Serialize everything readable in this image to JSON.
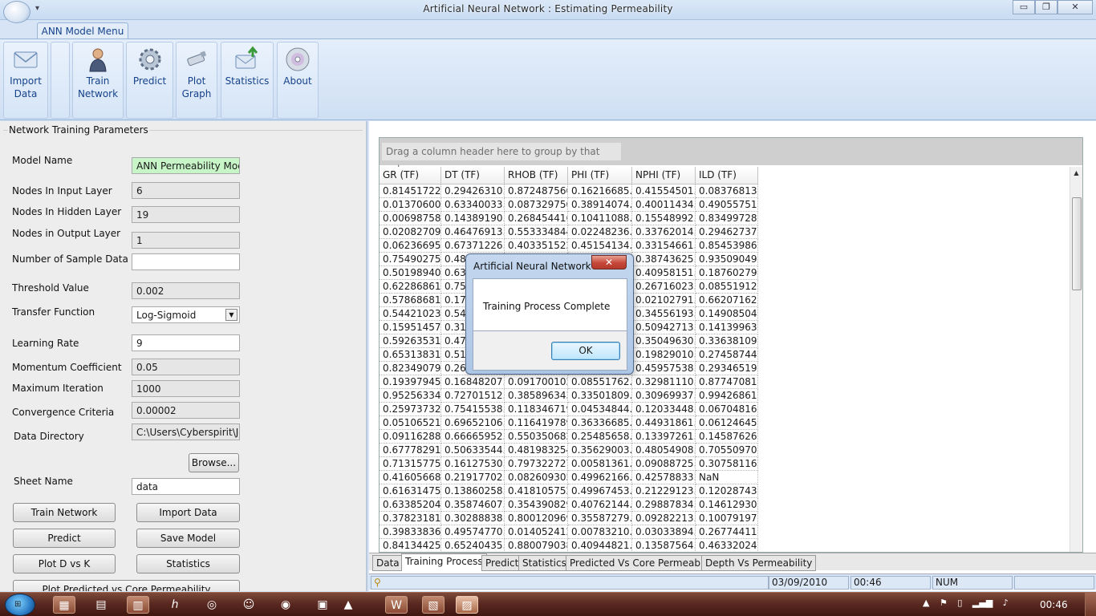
{
  "window": {
    "title": "Artificial Neural Network : Estimating Permeability",
    "qat_icons": [
      "dropdown-icon"
    ],
    "controls": {
      "minimize": "▭",
      "maximize": "❐",
      "close": "✕"
    }
  },
  "ribbon": {
    "tab": "ANN Model Menu",
    "buttons": [
      {
        "line1": "Import",
        "line2": "Data",
        "icon": "envelope-icon"
      },
      {
        "line1": "Train",
        "line2": "Network",
        "icon": "person-icon"
      },
      {
        "line1": "Predict",
        "line2": "",
        "icon": "gear-icon"
      },
      {
        "line1": "Plot",
        "line2": "Graph",
        "icon": "usb-drive-icon"
      },
      {
        "line1": "Statistics",
        "line2": "",
        "icon": "mail-upload-icon"
      },
      {
        "line1": "About",
        "line2": "",
        "icon": "disc-icon"
      }
    ]
  },
  "params": {
    "group_title": "Network Training Parameters",
    "model_name_label": "Model Name",
    "model_name": "ANN Permeability Model",
    "input_layer_label": "Nodes In Input Layer",
    "input_layer": "6",
    "hidden_layer_label": "Nodes In Hidden Layer",
    "hidden_layer": "19",
    "output_layer_label": "Nodes in Output Layer",
    "output_layer": "1",
    "sample_label": "Number of  Sample Data",
    "sample": "",
    "threshold_label": "Threshold Value",
    "threshold": "0.002",
    "transfer_label": "Transfer Function",
    "transfer": "Log-Sigmoid",
    "learning_label": "Learning Rate",
    "learning": "9",
    "momentum_label": "Momentum Coefficient",
    "momentum": "0.05",
    "max_iter_label": "Maximum Iteration",
    "max_iter": "1000",
    "convergence_label": "Convergence Criteria",
    "convergence": "0.00002",
    "data_dir_label": "Data Directory",
    "data_dir": "C:\\Users\\Cyberspirit\\Job",
    "browse": "Browse...",
    "sheet_label": "Sheet Name",
    "sheet": "data",
    "btn_train": "Train Network",
    "btn_import": "Import Data",
    "btn_predict": "Predict",
    "btn_save": "Save Model",
    "btn_plot": "Plot D vs K",
    "btn_stats": "Statistics",
    "btn_plot_pred": "Plot Predicted vs Core Permeability"
  },
  "grid": {
    "group_hint": "Drag a column header here to group by that column.",
    "columns": [
      "GR (TF)",
      "DT (TF)",
      "RHOB (TF)",
      "PHI (TF)",
      "NPHI (TF)",
      "ILD (TF)"
    ],
    "rows": [
      [
        "0.81451722...",
        "0.29426310...",
        "0.872487560...",
        "0.16216685...",
        "0.41554501...",
        "0.08376813..."
      ],
      [
        "0.01370600...",
        "0.63340033...",
        "0.087329750...",
        "0.38914074...",
        "0.40011434...",
        "0.49055751..."
      ],
      [
        "0.00698758...",
        "0.14389190...",
        "0.268454416...",
        "0.10411088...",
        "0.15548992...",
        "0.83499728..."
      ],
      [
        "0.02082709...",
        "0.46476913...",
        "0.553334844...",
        "0.02248236...",
        "0.33762014...",
        "0.29462737..."
      ],
      [
        "0.06236695...",
        "0.67371226...",
        "0.403351522...",
        "0.45154134...",
        "0.33154661...",
        "0.85453986..."
      ],
      [
        "0.75490275...",
        "0.48",
        "",
        "",
        "0.38743625...",
        "0.93509049..."
      ],
      [
        "0.50198940...",
        "0.63",
        "",
        "",
        "0.40958151...",
        "0.18760279..."
      ],
      [
        "0.62286861...",
        "0.75",
        "",
        "",
        "0.26716023...",
        "0.08551912..."
      ],
      [
        "0.57868681...",
        "0.17",
        "",
        "",
        "0.02102791...",
        "0.66207162..."
      ],
      [
        "0.54421023...",
        "0.54",
        "",
        "",
        "0.34556193...",
        "0.14908504..."
      ],
      [
        "0.15951457...",
        "0.31",
        "",
        "",
        "0.50942713...",
        "0.14139963..."
      ],
      [
        "0.59263531...",
        "0.47",
        "",
        "",
        "0.35049630...",
        "0.33638109..."
      ],
      [
        "0.65313831...",
        "0.51",
        "",
        "",
        "0.19829010...",
        "0.27458744..."
      ],
      [
        "0.82349079...",
        "0.26",
        "",
        "",
        "0.45957538...",
        "0.29346519..."
      ],
      [
        "0.19397945...",
        "0.16848207...",
        "0.091700102...",
        "0.08551762...",
        "0.32981110...",
        "0.87747081..."
      ],
      [
        "0.95256334...",
        "0.72701512...",
        "0.385896343...",
        "0.33501809...",
        "0.30969937...",
        "0.99426861..."
      ],
      [
        "0.25973732...",
        "0.75415538...",
        "0.118346719...",
        "0.04534844...",
        "0.12033448...",
        "0.06704816..."
      ],
      [
        "0.05106521...",
        "0.69652106...",
        "0.116419789...",
        "0.36336685...",
        "0.44931861...",
        "0.06124645..."
      ],
      [
        "0.09116288...",
        "0.66665952...",
        "0.550350682...",
        "0.25485658...",
        "0.13397261...",
        "0.14587626..."
      ],
      [
        "0.67778291...",
        "0.50633544...",
        "0.481983254...",
        "0.35629003...",
        "0.48054908...",
        "0.70550970..."
      ],
      [
        "0.71315775...",
        "0.16127530...",
        "0.797322727...",
        "0.00581361...",
        "0.09088725...",
        "0.30758116..."
      ],
      [
        "0.41605668...",
        "0.21917702...",
        "0.082609305...",
        "0.49962166...",
        "0.42578833...",
        "NaN"
      ],
      [
        "0.61631475...",
        "0.13860258...",
        "0.418105752...",
        "0.49967453...",
        "0.21229123...",
        "0.12028743..."
      ],
      [
        "0.63385204...",
        "0.35874607...",
        "0.354390829...",
        "0.40762144...",
        "0.29887834...",
        "0.14612930..."
      ],
      [
        "0.37823181...",
        "0.30288838...",
        "0.800120969...",
        "0.35587279...",
        "0.09282213...",
        "0.10079197..."
      ],
      [
        "0.39833836...",
        "0.49574770...",
        "0.014052412...",
        "0.00783210...",
        "0.03033894...",
        "0.26774411..."
      ],
      [
        "0.84134425...",
        "0.65240435...",
        "0.880079038...",
        "0.40944821...",
        "0.13587564...",
        "0.46332024..."
      ]
    ]
  },
  "tabs": [
    "Data",
    "Training Process",
    "Predict",
    "Statistics",
    "Predicted Vs Core Permeability",
    "Depth Vs Permeability"
  ],
  "active_tab": "Training Process",
  "status": {
    "date": "03/09/2010",
    "time": "00:46",
    "num": "NUM"
  },
  "dialog": {
    "title": "Artificial Neural Network",
    "message": "Training Process Complete",
    "ok": "OK",
    "close": "✕"
  },
  "taskbar": {
    "clock": "00:46",
    "icons": [
      "explorer-icon",
      "folder-icon",
      "hp-icon",
      "network-icon",
      "smiley-icon",
      "chrome-icon",
      "winrar-icon",
      "vlc-icon",
      "word-icon",
      "app-window-icon",
      "app-window-active-icon"
    ]
  }
}
